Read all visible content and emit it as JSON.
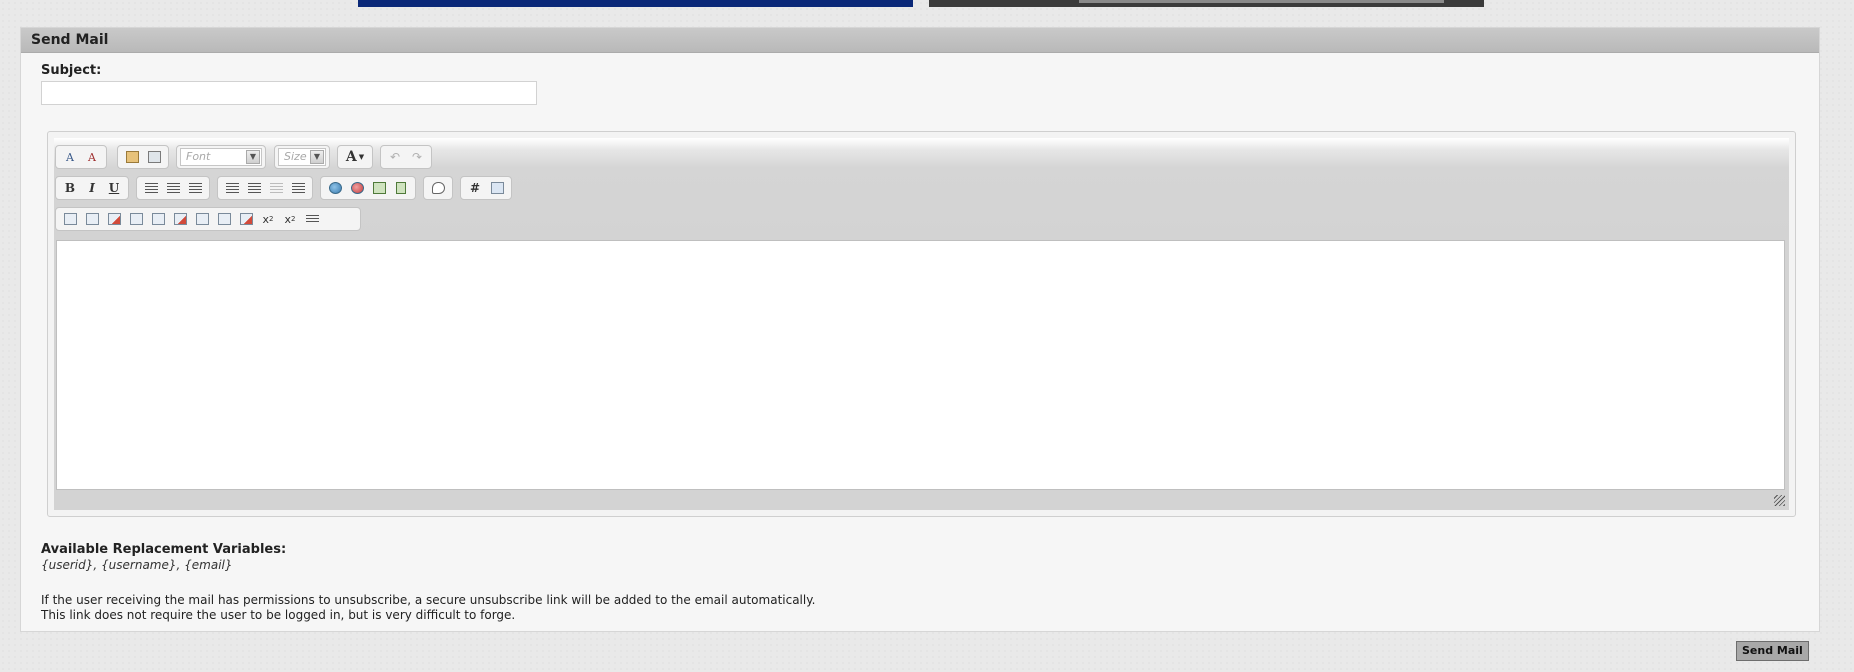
{
  "panel": {
    "title": "Send Mail"
  },
  "subject": {
    "label": "Subject:",
    "value": "",
    "placeholder": ""
  },
  "editor": {
    "font_placeholder": "Font",
    "size_placeholder": "Size",
    "font_color_glyph": "A",
    "bold": "B",
    "italic": "I",
    "underline": "U",
    "hash": "#",
    "subscript": "x",
    "superscript": "x",
    "content": ""
  },
  "variables": {
    "label": "Available Replacement Variables:",
    "list": "{userid}, {username}, {email}"
  },
  "notice": {
    "line1": "If the user receiving the mail has permissions to unsubscribe, a secure unsubscribe link will be added to the email automatically.",
    "line2": "This link does not require the user to be logged in, but is very difficult to forge."
  },
  "actions": {
    "send_label": "Send Mail"
  },
  "colors": {
    "accent_header": "#bfbfbf",
    "banner_left": "#0a2878",
    "banner_right": "#3b3b3b"
  }
}
